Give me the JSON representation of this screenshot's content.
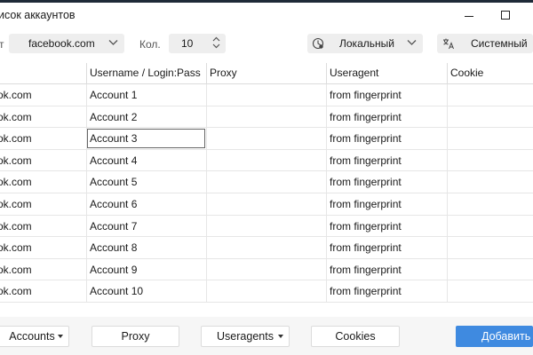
{
  "window": {
    "title": "исок аккаунтов"
  },
  "toolbar": {
    "label_site": "т",
    "site_value": "facebook.com",
    "count_label": "Кол.",
    "count_value": "10",
    "proxy_mode": "Локальный",
    "language": "Системный"
  },
  "table": {
    "columns": [
      "",
      "Username / Login:Pass",
      "Proxy",
      "Useragent",
      "Cookie"
    ],
    "rows": [
      {
        "site": "ok.com",
        "account": "Account 1",
        "proxy": "",
        "useragent": "from fingerprint",
        "cookie": ""
      },
      {
        "site": "ok.com",
        "account": "Account 2",
        "proxy": "",
        "useragent": "from fingerprint",
        "cookie": ""
      },
      {
        "site": "ok.com",
        "account": "Account 3",
        "proxy": "",
        "useragent": "from fingerprint",
        "cookie": ""
      },
      {
        "site": "ok.com",
        "account": "Account 4",
        "proxy": "",
        "useragent": "from fingerprint",
        "cookie": ""
      },
      {
        "site": "ok.com",
        "account": "Account 5",
        "proxy": "",
        "useragent": "from fingerprint",
        "cookie": ""
      },
      {
        "site": "ok.com",
        "account": "Account 6",
        "proxy": "",
        "useragent": "from fingerprint",
        "cookie": ""
      },
      {
        "site": "ok.com",
        "account": "Account 7",
        "proxy": "",
        "useragent": "from fingerprint",
        "cookie": ""
      },
      {
        "site": "ok.com",
        "account": "Account 8",
        "proxy": "",
        "useragent": "from fingerprint",
        "cookie": ""
      },
      {
        "site": "ok.com",
        "account": "Account 9",
        "proxy": "",
        "useragent": "from fingerprint",
        "cookie": ""
      },
      {
        "site": "ok.com",
        "account": "Account 10",
        "proxy": "",
        "useragent": "from fingerprint",
        "cookie": ""
      }
    ],
    "selected_row": 2
  },
  "bottom": {
    "accounts": "Accounts",
    "proxy": "Proxy",
    "useragents": "Useragents",
    "cookies": "Cookies",
    "add": "Добавить"
  },
  "colors": {
    "accent": "#3f8ae0",
    "title_strip": "#1e2a38"
  },
  "icons": [
    "minimize-icon",
    "maximize-icon",
    "chevron-down-icon",
    "stepper-up-icon",
    "stepper-down-icon",
    "proxy-globe-icon",
    "translate-icon",
    "caret-down-icon"
  ]
}
